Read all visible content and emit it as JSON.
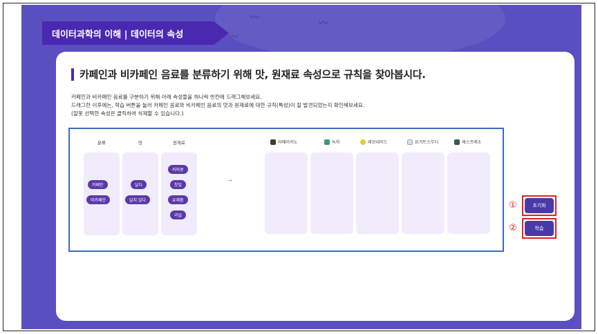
{
  "title_tab": "데이터과학의 이해  |  데이터의 속성",
  "heading": "카페인과 비카페인 음료를 분류하기 위해 맛, 원재료 속성으로 규칙을 찾아봅시다.",
  "instructions": [
    "카페인과 비카페인 음료를 구분하기 위해 아래 속성들을 하나씩 빈칸에 드래그해보세요.",
    "드래그한 이후에는, 학습 버튼을 눌러 카페인 음료와 비카페인 음료의 맛과 원재료에 대한 규칙(특성)이 잘 발견되었는지 확인해보세요.",
    "(잘못 선택한 속성은 클릭하여 삭제할 수 있습니다.)"
  ],
  "attribute_columns": [
    {
      "header": "분류",
      "chips": [
        "카페인",
        "비카페인"
      ]
    },
    {
      "header": "맛",
      "chips": [
        "달다",
        "달지 않다"
      ]
    },
    {
      "header": "원재료",
      "chips": [
        "커피콩",
        "찻잎",
        "유제품",
        "과일"
      ]
    }
  ],
  "arrow": "→",
  "beverages": [
    {
      "name": "아메리카노",
      "icon": "americano-cup-icon",
      "color": "#4a3a2a"
    },
    {
      "name": "녹차",
      "icon": "green-tea-cup-icon",
      "color": "#3a9a7a"
    },
    {
      "name": "레모네이드",
      "icon": "lemonade-icon",
      "color": "#e8c93a"
    },
    {
      "name": "요거트스무디",
      "icon": "smoothie-cup-icon",
      "color": "#cfe0f5"
    },
    {
      "name": "에스프레소",
      "icon": "espresso-cup-icon",
      "color": "#3a5a5a"
    }
  ],
  "buttons": {
    "reset": {
      "number": "①",
      "label": "초기화"
    },
    "learn": {
      "number": "②",
      "label": "학습"
    }
  }
}
